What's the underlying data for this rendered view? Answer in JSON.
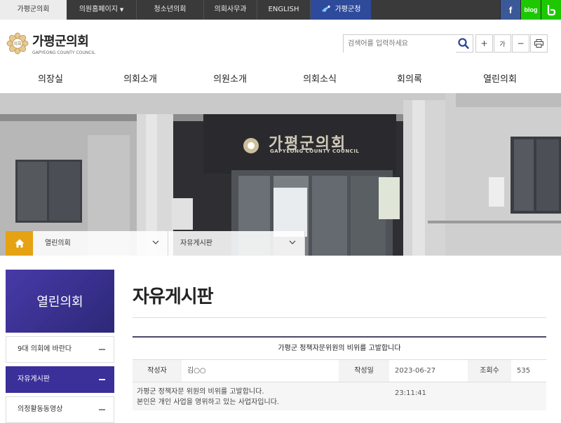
{
  "topbar": {
    "tabs": [
      {
        "label": "가평군의회"
      },
      {
        "label": "의원홈페이지"
      },
      {
        "label": "청소년의회"
      },
      {
        "label": "의회사무과"
      },
      {
        "label": "ENGLISH"
      },
      {
        "label": "가평군청"
      }
    ],
    "sns": {
      "facebook": "f",
      "blog": "blog"
    }
  },
  "logo": {
    "name": "가평군의회",
    "name_en": "GAPYEONG COUNTY COUNCIL",
    "emblem_text": "의회"
  },
  "search": {
    "placeholder": "검색어를 입력하세요"
  },
  "tools": {
    "plus": "+",
    "font": "가",
    "minus": "−"
  },
  "gnb": [
    "의장실",
    "의회소개",
    "의원소개",
    "의회소식",
    "회의록",
    "열린의회"
  ],
  "hero": {
    "sign_ko": "가평군의회",
    "sign_en": "GAPYEONG COUNTY COUNCIL"
  },
  "breadcrumb": {
    "level1": "열린의회",
    "level2": "자유게시판"
  },
  "lnb": {
    "title": "열린의회",
    "items": [
      {
        "label": "9대 의회에 바란다"
      },
      {
        "label": "자유게시판"
      },
      {
        "label": "의정활동동영상"
      }
    ]
  },
  "page": {
    "title": "자유게시판"
  },
  "post": {
    "title": "가평군 정책자문위원의 비위를 고발합니다",
    "author_label": "작성자",
    "author": "김○○",
    "date_label": "작성일",
    "date": "2023-06-27 23:11:41",
    "views_label": "조회수",
    "views": "535",
    "body_line1": "가평군 정책자문 위원의 비위를 고발합니다.",
    "body_line2": "본인은 개인 사업을 영위하고 있는 사업자입니다."
  },
  "colors": {
    "accent": "#3b2f9a",
    "home": "#e5a212",
    "topbar": "#3a3a3a",
    "sns_green": "#1ec800",
    "fb": "#3b5998"
  }
}
